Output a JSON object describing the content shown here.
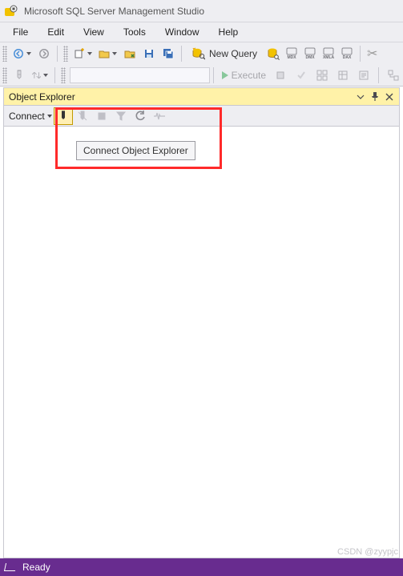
{
  "app": {
    "title": "Microsoft SQL Server Management Studio"
  },
  "menu": {
    "file": "File",
    "edit": "Edit",
    "view": "View",
    "tools": "Tools",
    "window": "Window",
    "help": "Help"
  },
  "toolbar1": {
    "nav_back_tip": "Navigate Back",
    "nav_fwd_tip": "Navigate Forward",
    "new_project_tip": "New Project",
    "open_tip": "Open File",
    "save_tip": "Save",
    "save_all_tip": "Save All",
    "new_query_label": "New Query",
    "db_engine_tip": "Database Engine Query",
    "mdx_tip": "MDX",
    "dmx_tip": "DMX",
    "xmla_tip": "XMLA",
    "dax_tip": "DAX",
    "cut_tip": "Cut"
  },
  "toolbar2": {
    "execute_label": "Execute"
  },
  "panel": {
    "title": "Object Explorer",
    "connect_label": "Connect",
    "connect_tip": "Connect",
    "disconnect_tip": "Disconnect",
    "stop_tip": "Stop",
    "filter_tip": "Filter",
    "refresh_tip": "Refresh",
    "activity_tip": "Activity Monitor"
  },
  "tooltip": "Connect Object Explorer",
  "status": {
    "text": "Ready"
  },
  "watermark": "CSDN @zyypjc"
}
